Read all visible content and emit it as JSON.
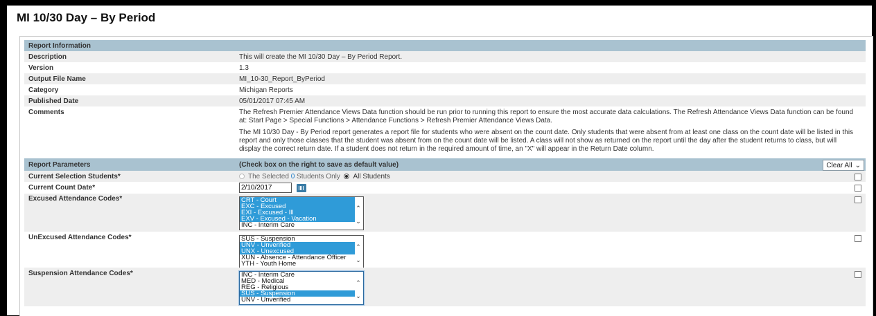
{
  "page": {
    "title": "MI 10/30 Day – By Period"
  },
  "report_info": {
    "header": "Report Information",
    "rows": [
      {
        "label": "Description",
        "value": "This will create the MI 10/30 Day – By Period Report."
      },
      {
        "label": "Version",
        "value": "1.3"
      },
      {
        "label": "Output File Name",
        "value": "MI_10-30_Report_ByPeriod"
      },
      {
        "label": "Category",
        "value": "Michigan Reports"
      },
      {
        "label": "Published Date",
        "value": "05/01/2017 07:45 AM"
      }
    ],
    "comments": {
      "label": "Comments",
      "para1": "The Refresh Premier Attendance Views Data function should be run prior to running this report to ensure the most accurate data calculations. The Refresh Attendance Views Data function can be found at: Start Page > Special Functions > Attendance Functions > Refresh Premier Attendance Views Data.",
      "para2": "The MI 10/30 Day - By Period report generates a report file for students who were absent on the count date. Only students that were absent from at least one class on the count date will be listed in this report and only those classes that the student was absent from on the count date will be listed. A class will not show as returned on the report until the day after the student returns to class, but will display the correct return date. If a student does not return in the required amount of time, an \"X\" will appear in the Return Date column."
    }
  },
  "params": {
    "header": "Report Parameters",
    "hint": "(Check box on the right to save as default value)",
    "clear_all": "Clear All",
    "selection": {
      "label": "Current Selection Students*",
      "opt1_prefix": "The Selected ",
      "opt1_count": "0",
      "opt1_suffix": " Students Only",
      "opt2": "All Students"
    },
    "count_date": {
      "label": "Current Count Date*",
      "value": "2/10/2017"
    },
    "excused": {
      "label": "Excused Attendance Codes*",
      "options": [
        {
          "text": "CRT - Court",
          "selected": true
        },
        {
          "text": "EXC - Excused",
          "selected": true
        },
        {
          "text": "EXI - Excused - Ill",
          "selected": true
        },
        {
          "text": "EXV - Excused - Vacation",
          "selected": true
        },
        {
          "text": "INC - Interim Care",
          "selected": false
        }
      ]
    },
    "unexcused": {
      "label": "UnExcused Attendance Codes*",
      "options": [
        {
          "text": "SUS - Suspension",
          "selected": false
        },
        {
          "text": "UNV - Unverified",
          "selected": true
        },
        {
          "text": "UNX - Unexcused",
          "selected": true
        },
        {
          "text": "XUN - Absence - Attendance Officer",
          "selected": false
        },
        {
          "text": "YTH - Youth Home",
          "selected": false
        }
      ]
    },
    "suspension": {
      "label": "Suspension Attendance Codes*",
      "options": [
        {
          "text": "INC - Interim Care",
          "selected": false
        },
        {
          "text": "MED - Medical",
          "selected": false
        },
        {
          "text": "REG - Religious",
          "selected": false
        },
        {
          "text": "SUS - Suspension",
          "selected": true
        },
        {
          "text": "UNV - Unverified",
          "selected": false
        }
      ]
    }
  },
  "colors": {
    "section_header": "#a9c2d0",
    "selected_option": "#2f9bd8",
    "alt_row": "#eeeeee"
  }
}
